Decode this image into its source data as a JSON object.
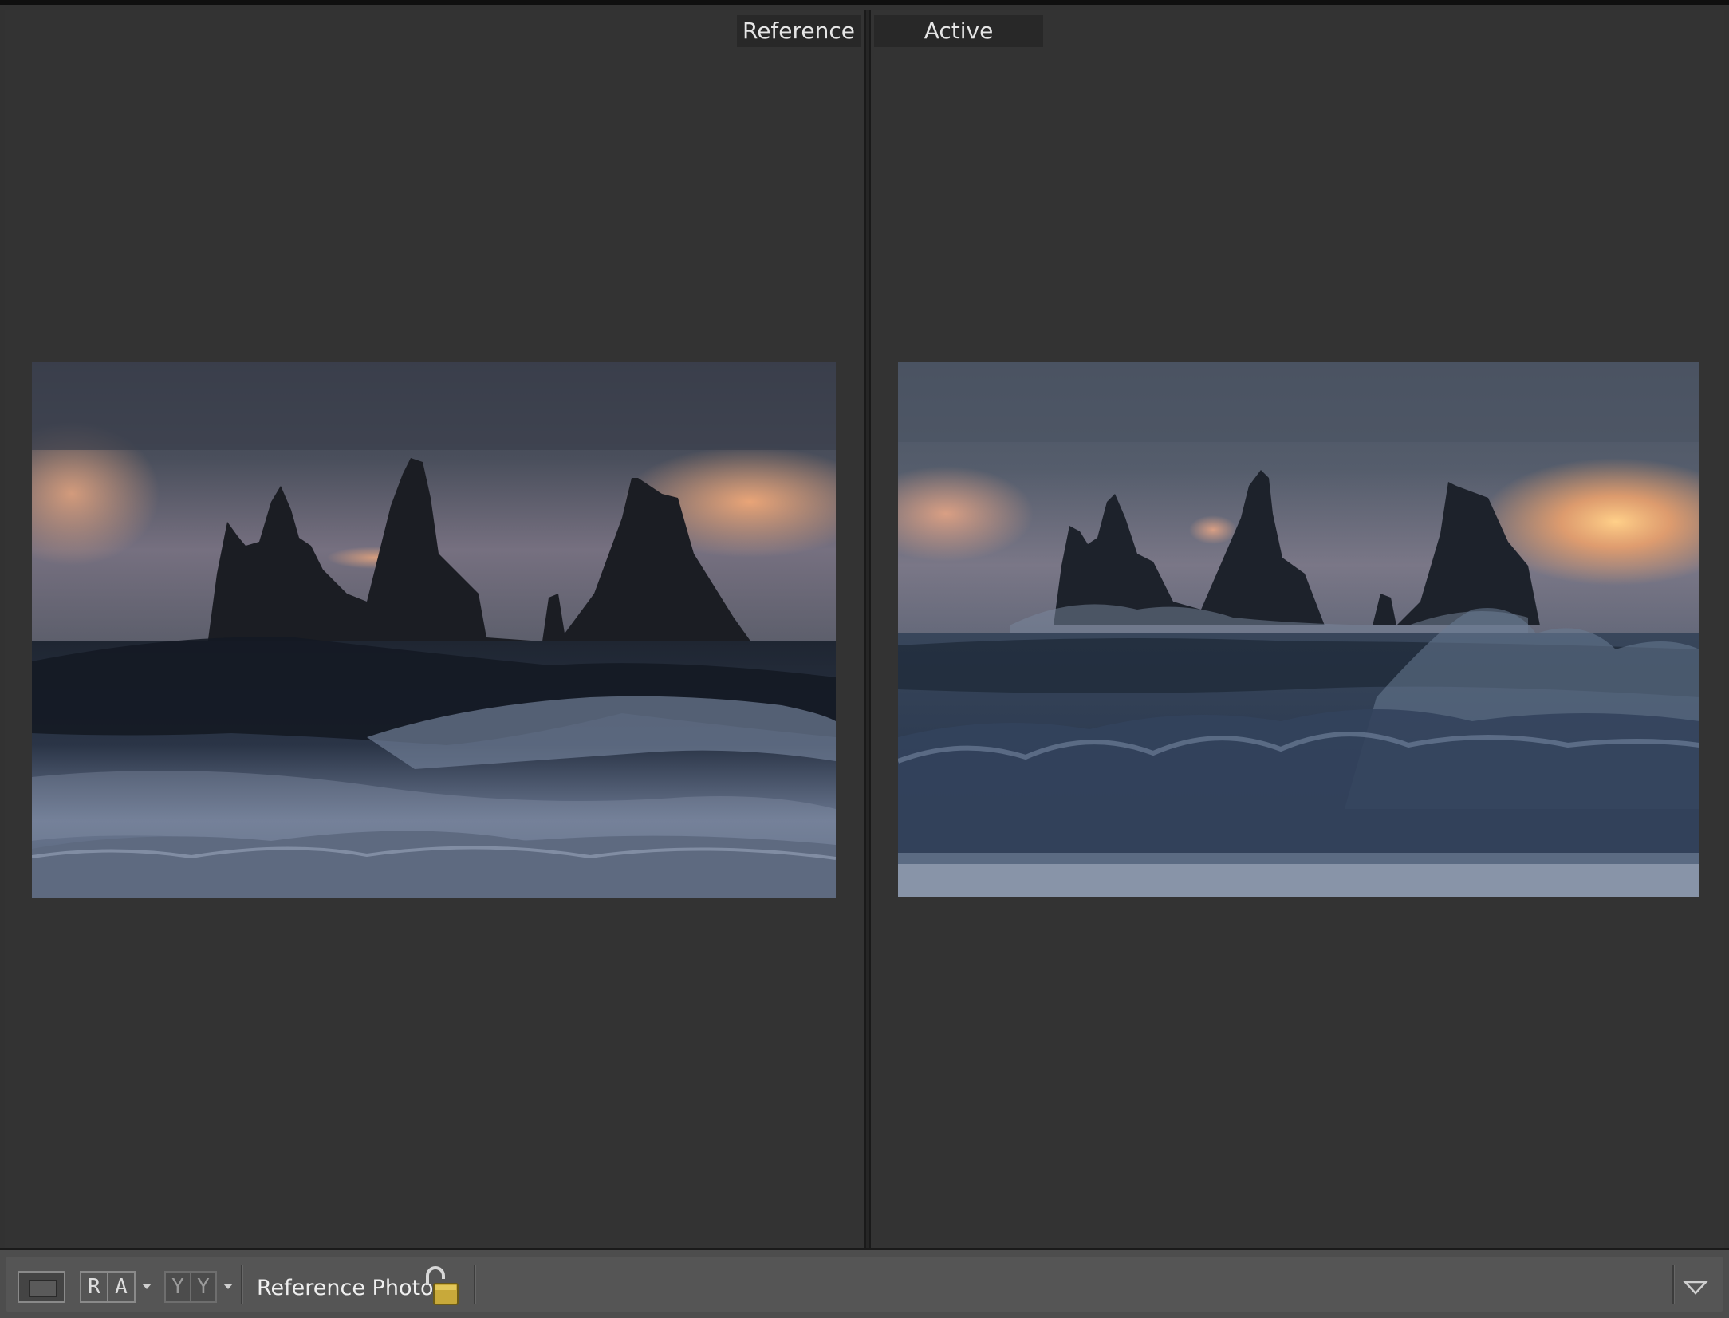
{
  "panes": {
    "reference": {
      "label": "Reference"
    },
    "active": {
      "label": "Active"
    }
  },
  "toolbar": {
    "loupe_button": "loupe-view-icon",
    "ref_active_left": "R",
    "ref_active_right": "A",
    "yy_left": "Y",
    "yy_right": "Y",
    "reference_photo_label": "Reference Photo :",
    "lock_state": "unlocked"
  },
  "colors": {
    "background": "#323232",
    "toolbar": "#555555",
    "label_bg": "#282828",
    "lock": "#c8a93a"
  }
}
